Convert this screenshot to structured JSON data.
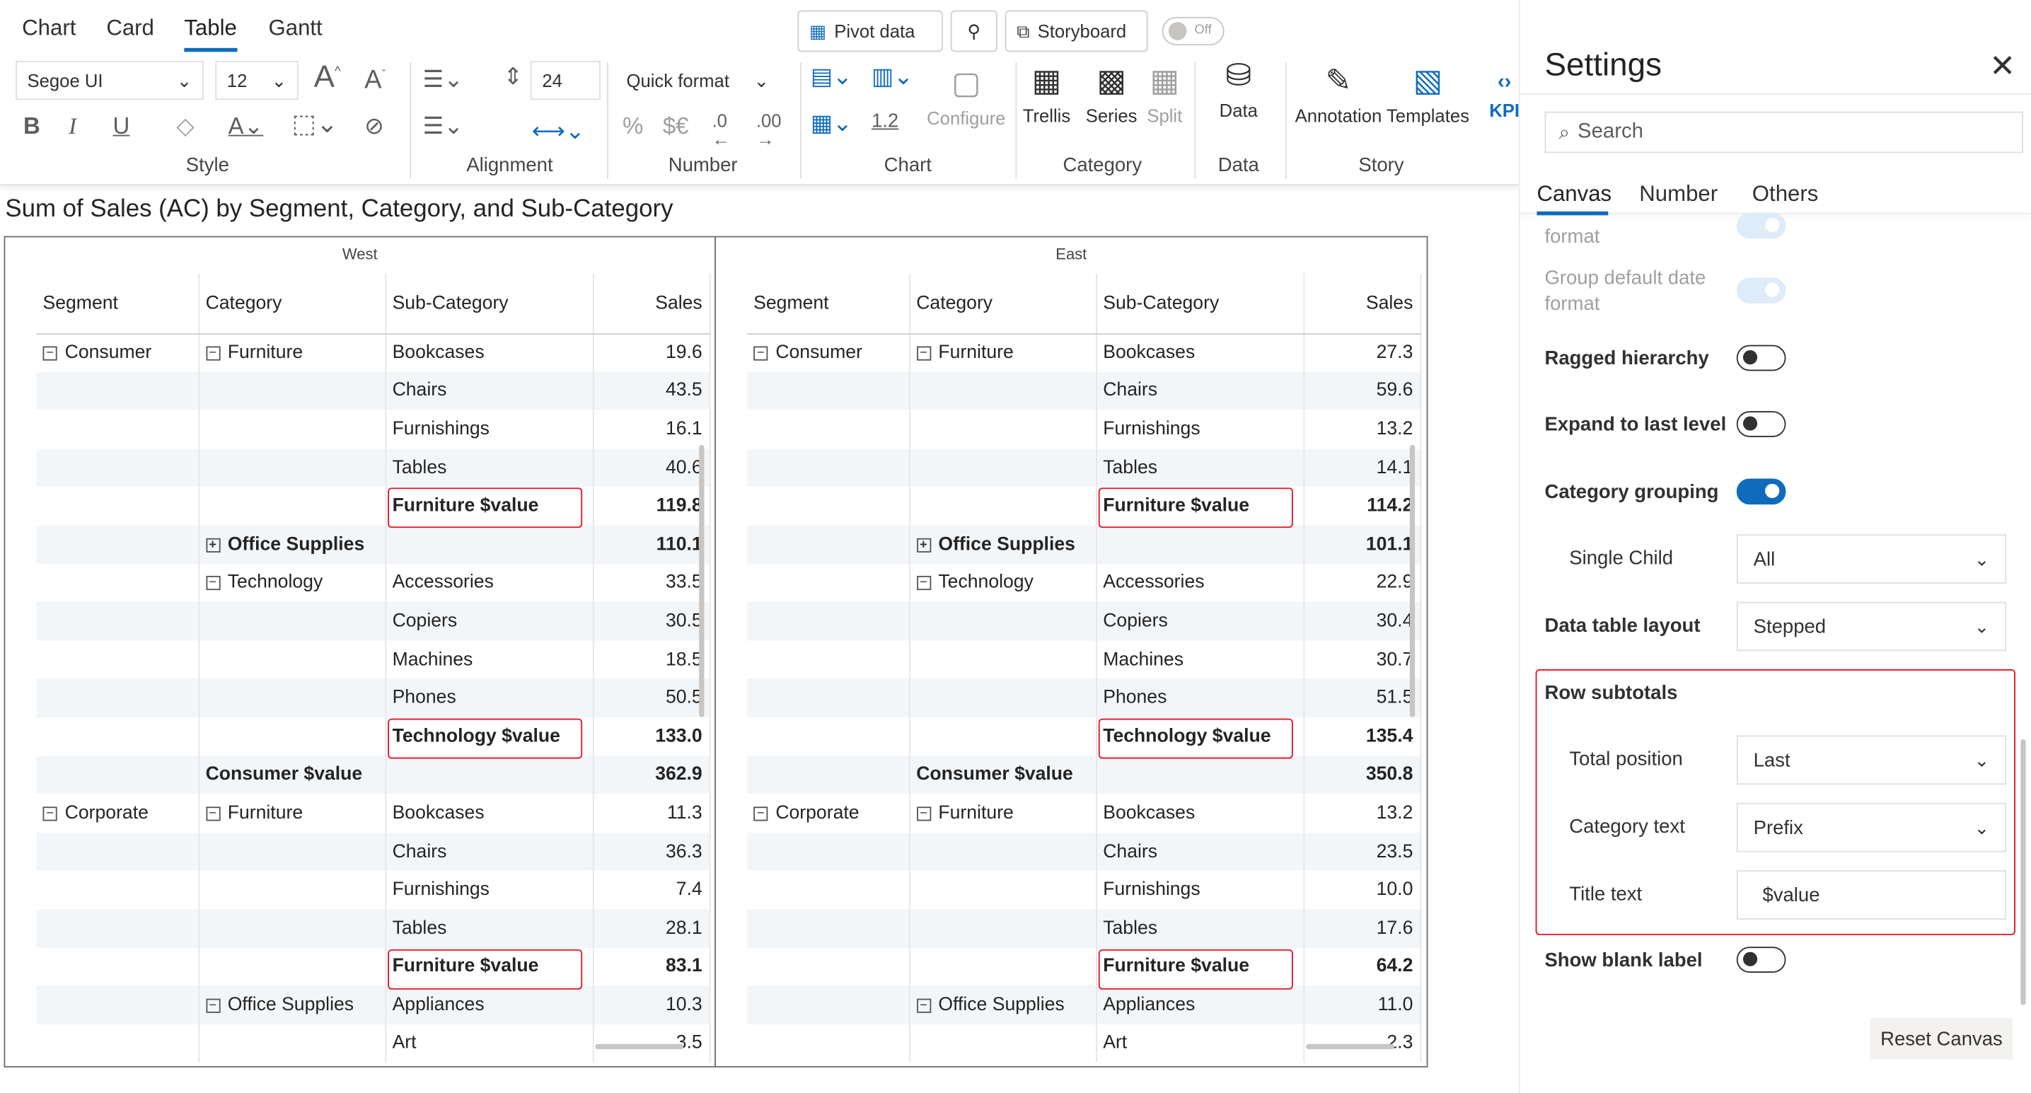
{
  "ribbon": {
    "tabs": [
      "Chart",
      "Card",
      "Table",
      "Gantt"
    ],
    "pivot_data": "Pivot data",
    "storyboard": "Storyboard",
    "toggle_off": "Off",
    "font_family": "Segoe UI",
    "font_size": "12",
    "line_height_value": "24",
    "quick_format": "Quick format",
    "decimal_value": "1.2",
    "configure": "Configure",
    "trellis": "Trellis",
    "series": "Series",
    "split": "Split",
    "data": "Data",
    "annotation": "Annotation",
    "templates": "Templates",
    "kpi": "KPI",
    "groups": {
      "style": "Style",
      "alignment": "Alignment",
      "number": "Number",
      "chart": "Chart",
      "category": "Category",
      "data": "Data",
      "story": "Story"
    }
  },
  "chart": {
    "title": "Sum of Sales (AC) by Segment, Category, and Sub-Category",
    "columns": [
      "Segment",
      "Category",
      "Sub-Category",
      "Sales"
    ],
    "panels": [
      {
        "name": "West",
        "rows": [
          [
            "Consumer",
            "Furniture",
            "Bookcases",
            "19.6"
          ],
          [
            "",
            "",
            "Chairs",
            "43.5"
          ],
          [
            "",
            "",
            "Furnishings",
            "16.1"
          ],
          [
            "",
            "",
            "Tables",
            "40.6"
          ],
          [
            "",
            "",
            "Furniture $value",
            "119.8"
          ],
          [
            "",
            "Office Supplies",
            "",
            "110.1"
          ],
          [
            "",
            "Technology",
            "Accessories",
            "33.5"
          ],
          [
            "",
            "",
            "Copiers",
            "30.5"
          ],
          [
            "",
            "",
            "Machines",
            "18.5"
          ],
          [
            "",
            "",
            "Phones",
            "50.5"
          ],
          [
            "",
            "",
            "Technology $value",
            "133.0"
          ],
          [
            "",
            "Consumer $value",
            "",
            "362.9"
          ],
          [
            "Corporate",
            "Furniture",
            "Bookcases",
            "11.3"
          ],
          [
            "",
            "",
            "Chairs",
            "36.3"
          ],
          [
            "",
            "",
            "Furnishings",
            "7.4"
          ],
          [
            "",
            "",
            "Tables",
            "28.1"
          ],
          [
            "",
            "",
            "Furniture $value",
            "83.1"
          ],
          [
            "",
            "Office Supplies",
            "Appliances",
            "10.3"
          ],
          [
            "",
            "",
            "Art",
            "3.5"
          ]
        ]
      },
      {
        "name": "East",
        "rows": [
          [
            "Consumer",
            "Furniture",
            "Bookcases",
            "27.3"
          ],
          [
            "",
            "",
            "Chairs",
            "59.6"
          ],
          [
            "",
            "",
            "Furnishings",
            "13.2"
          ],
          [
            "",
            "",
            "Tables",
            "14.1"
          ],
          [
            "",
            "",
            "Furniture $value",
            "114.2"
          ],
          [
            "",
            "Office Supplies",
            "",
            "101.1"
          ],
          [
            "",
            "Technology",
            "Accessories",
            "22.9"
          ],
          [
            "",
            "",
            "Copiers",
            "30.4"
          ],
          [
            "",
            "",
            "Machines",
            "30.7"
          ],
          [
            "",
            "",
            "Phones",
            "51.5"
          ],
          [
            "",
            "",
            "Technology $value",
            "135.4"
          ],
          [
            "",
            "Consumer $value",
            "",
            "350.8"
          ],
          [
            "Corporate",
            "Furniture",
            "Bookcases",
            "13.2"
          ],
          [
            "",
            "",
            "Chairs",
            "23.5"
          ],
          [
            "",
            "",
            "Furnishings",
            "10.0"
          ],
          [
            "",
            "",
            "Tables",
            "17.6"
          ],
          [
            "",
            "",
            "Furniture $value",
            "64.2"
          ],
          [
            "",
            "Office Supplies",
            "Appliances",
            "11.0"
          ],
          [
            "",
            "",
            "Art",
            "2.3"
          ]
        ]
      }
    ]
  },
  "settings": {
    "title": "Settings",
    "search_placeholder": "Search",
    "tabs": [
      "Canvas",
      "Number",
      "Others"
    ],
    "partial_label": "format",
    "group_date_format": "Group default date format",
    "ragged_hierarchy": "Ragged hierarchy",
    "expand_last_level": "Expand to last level",
    "category_grouping": "Category grouping",
    "single_child": {
      "label": "Single Child",
      "value": "All"
    },
    "data_table_layout": {
      "label": "Data table layout",
      "value": "Stepped"
    },
    "row_subtotals": "Row subtotals",
    "total_position": {
      "label": "Total position",
      "value": "Last"
    },
    "category_text": {
      "label": "Category text",
      "value": "Prefix"
    },
    "title_text": {
      "label": "Title text",
      "value": "$value"
    },
    "show_blank_label": "Show blank label",
    "reset_canvas": "Reset Canvas"
  }
}
